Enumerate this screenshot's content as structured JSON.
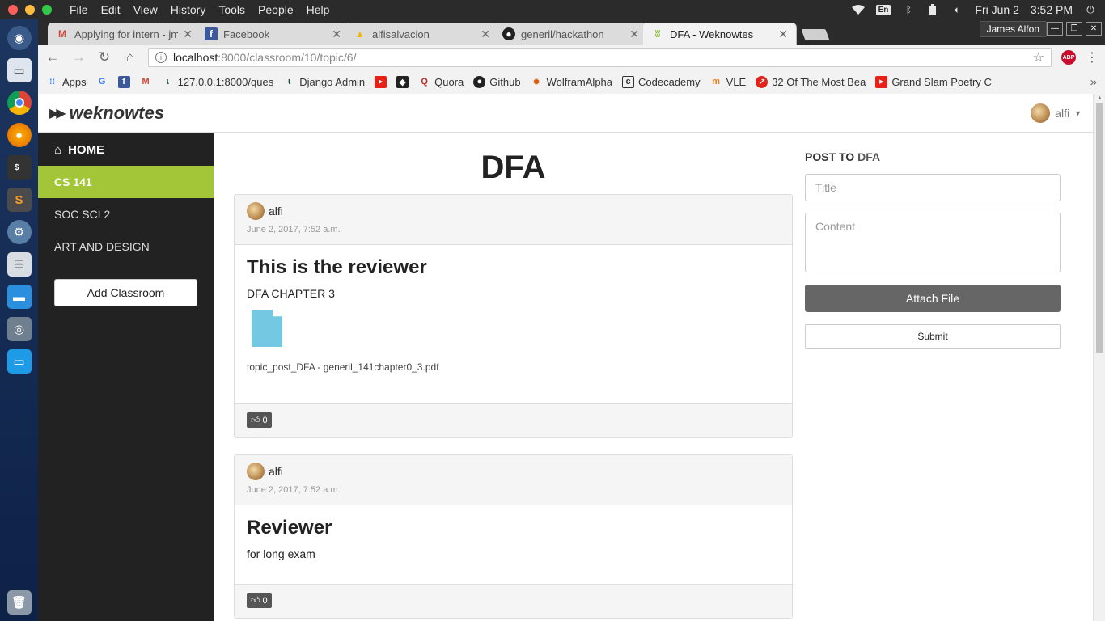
{
  "os": {
    "menu": [
      "File",
      "Edit",
      "View",
      "History",
      "Tools",
      "People",
      "Help"
    ],
    "input_lang": "En",
    "date": "Fri Jun  2",
    "time": "3:52 PM"
  },
  "browser": {
    "tabs": [
      {
        "title": "Applying for intern - jmc",
        "favicon": "gmail-icon",
        "color": "#d44638"
      },
      {
        "title": "Facebook",
        "favicon": "facebook-icon",
        "color": "#3b5998"
      },
      {
        "title": "alfisalvacion",
        "favicon": "drive-icon",
        "color": "#f4b400"
      },
      {
        "title": "generil/hackathon",
        "favicon": "github-icon",
        "color": "#222222"
      },
      {
        "title": "DFA - Weknowtes",
        "favicon": "weknowtes-icon",
        "color": "#8bbb32"
      }
    ],
    "profile_name": "James Alfon",
    "url_host": "localhost",
    "url_rest": ":8000/classroom/10/topic/6/",
    "bookmarks": [
      {
        "label": "Apps",
        "icon": "apps-icon"
      },
      {
        "label": "",
        "icon": "google-icon"
      },
      {
        "label": "",
        "icon": "facebook-icon"
      },
      {
        "label": "",
        "icon": "gmail-icon"
      },
      {
        "label": "127.0.0.1:8000/ques",
        "icon": "django-icon"
      },
      {
        "label": "Django Admin",
        "icon": "django-icon"
      },
      {
        "label": "",
        "icon": "youtube-icon"
      },
      {
        "label": "",
        "icon": "bookmark-icon"
      },
      {
        "label": "Quora",
        "icon": "quora-icon"
      },
      {
        "label": "Github",
        "icon": "github-icon"
      },
      {
        "label": "WolframAlpha",
        "icon": "wolfram-icon"
      },
      {
        "label": "Codecademy",
        "icon": "codecademy-icon"
      },
      {
        "label": "VLE",
        "icon": "vle-icon"
      },
      {
        "label": "32 Of The Most Bea",
        "icon": "trending-icon"
      },
      {
        "label": "Grand Slam Poetry C",
        "icon": "youtube-icon"
      }
    ]
  },
  "site": {
    "brand": "weknowtes",
    "username": "alfi"
  },
  "sidebar": {
    "home": "HOME",
    "items": [
      {
        "label": "CS 141",
        "active": true
      },
      {
        "label": "SOC SCI 2",
        "active": false
      },
      {
        "label": "ART AND DESIGN",
        "active": false
      }
    ],
    "add_classroom": "Add Classroom"
  },
  "topic": {
    "title": "DFA"
  },
  "posts": [
    {
      "author": "alfi",
      "date": "June 2, 2017, 7:52 a.m.",
      "title": "This is the reviewer",
      "text": "DFA CHAPTER 3",
      "file_name": "topic_post_DFA - generil_141chapter0_3.pdf",
      "likes": "0"
    },
    {
      "author": "alfi",
      "date": "June 2, 2017, 7:52 a.m.",
      "title": "Reviewer",
      "text": "for long exam",
      "likes": "0"
    }
  ],
  "composer": {
    "post_to_label": "POST TO",
    "post_to_topic": "DFA",
    "title_placeholder": "Title",
    "content_placeholder": "Content",
    "attach_label": "Attach File",
    "submit_label": "Submit"
  }
}
